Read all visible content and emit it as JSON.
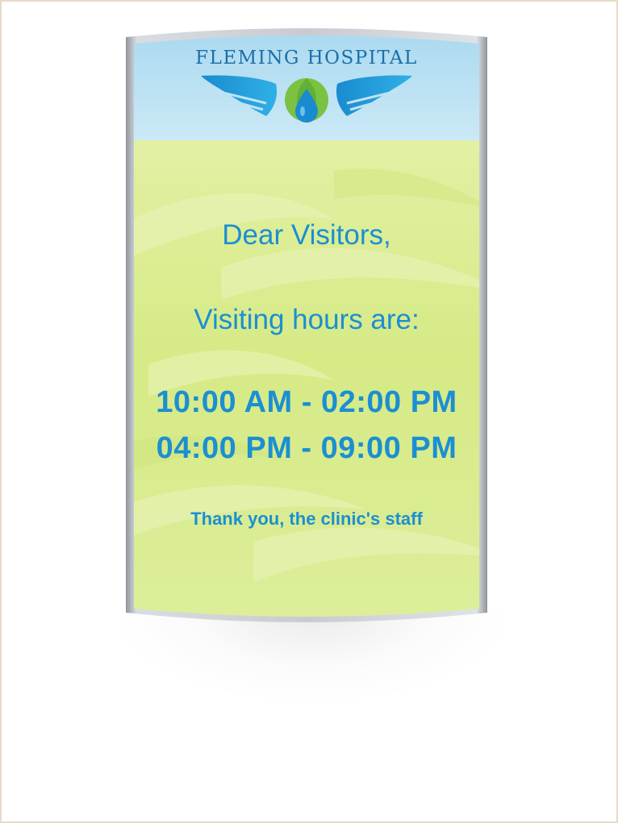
{
  "sign": {
    "title": "FLEMING HOSPITAL",
    "logo_icon": "winged-water-drop-icon",
    "greeting": "Dear Visitors,",
    "hours_heading": "Visiting hours are:",
    "hours": [
      "10:00 AM - 02:00 PM",
      "04:00 PM - 09:00 PM"
    ],
    "signoff": "Thank you, the clinic's staff"
  },
  "colors": {
    "header_blue": "#bfe3f4",
    "panel_green": "#d9ec8c",
    "text_blue": "#1b8fd2",
    "title_blue": "#1a6fa8",
    "frame_silver": "#b9bec4"
  }
}
